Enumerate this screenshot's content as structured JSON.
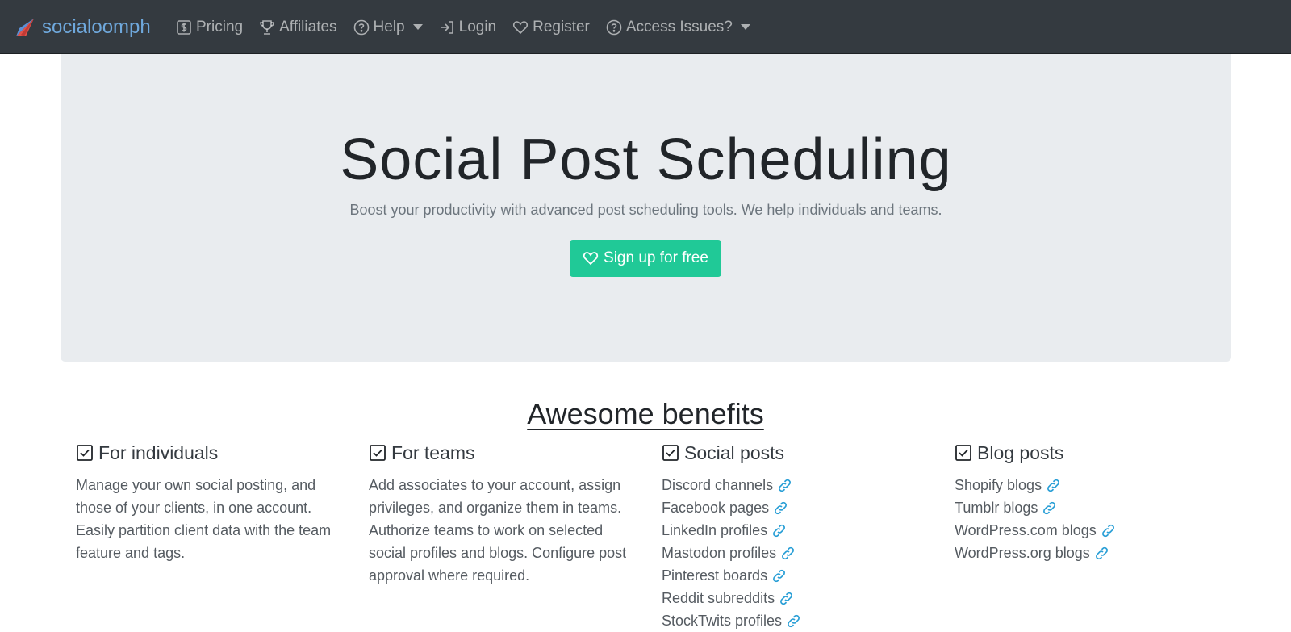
{
  "brand": {
    "name": "socialoomph",
    "logo_icon": "paper-plane-logo-icon"
  },
  "nav": {
    "items": [
      {
        "label": "Pricing",
        "icon": "dollar-icon"
      },
      {
        "label": "Affiliates",
        "icon": "trophy-icon"
      },
      {
        "label": "Help",
        "icon": "question-circle-icon",
        "dropdown": true
      },
      {
        "label": "Login",
        "icon": "sign-in-icon"
      },
      {
        "label": "Register",
        "icon": "heart-icon"
      },
      {
        "label": "Access Issues?",
        "icon": "question-circle-icon",
        "dropdown": true
      }
    ]
  },
  "hero": {
    "title": "Social Post Scheduling",
    "lead": "Boost your productivity with advanced post scheduling tools. We help individuals and teams.",
    "cta_label": "Sign up for free",
    "cta_icon": "heart-icon"
  },
  "benefits": {
    "title": "Awesome benefits",
    "individuals": {
      "heading": "For individuals",
      "text": "Manage your own social posting, and those of your clients, in one account. Easily partition client data with the team feature and tags."
    },
    "teams": {
      "heading": "For teams",
      "text": "Add associates to your account, assign privileges, and organize them in teams. Authorize teams to work on selected social profiles and blogs. Configure post approval where required."
    },
    "social": {
      "heading": "Social posts",
      "items": [
        "Discord channels",
        "Facebook pages",
        "LinkedIn profiles",
        "Mastodon profiles",
        "Pinterest boards",
        "Reddit subreddits",
        "StockTwits profiles"
      ]
    },
    "blog": {
      "heading": "Blog posts",
      "items": [
        "Shopify blogs",
        "Tumblr blogs",
        "WordPress.com blogs",
        "WordPress.org blogs"
      ]
    }
  },
  "colors": {
    "navbar_bg": "#343a40",
    "brand": "#6fa8dc",
    "jumbotron_bg": "#e9ecef",
    "cta_bg": "#20c997",
    "link_icon": "#2a9fd6"
  }
}
